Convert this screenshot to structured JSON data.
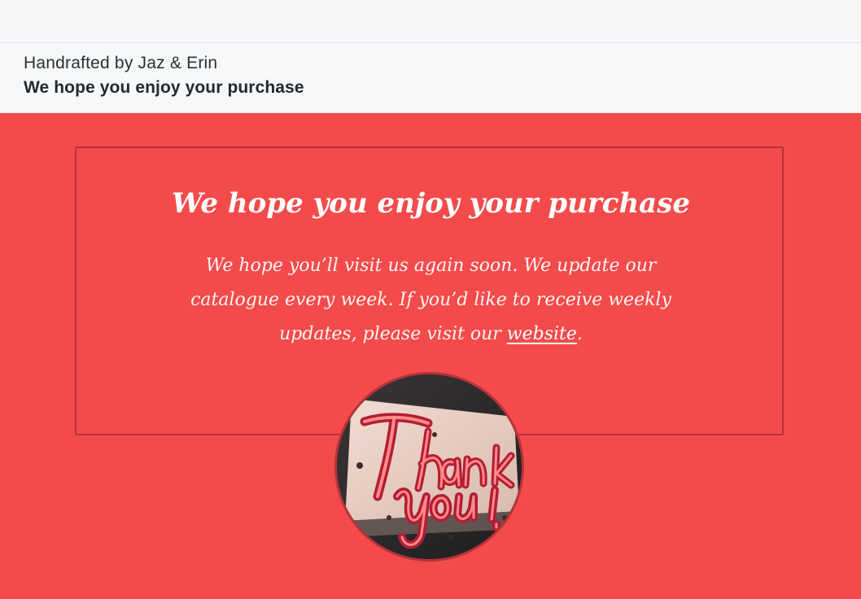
{
  "header": {
    "sender": "Handrafted by Jaz & Erin",
    "subject": "We hope you enjoy your purchase"
  },
  "card": {
    "headline": "We hope you enjoy your purchase",
    "message_before_link": "We hope you’ll visit us again soon. We update our catalogue every week. If you’d like to receive weekly updates, please visit our ",
    "link_text": "website",
    "message_after_link": ".",
    "image_alt": "Thank You neon sign"
  },
  "colors": {
    "body_background": "#f34b4b",
    "card_border": "#b8323a",
    "header_background": "#f7f8fa"
  }
}
